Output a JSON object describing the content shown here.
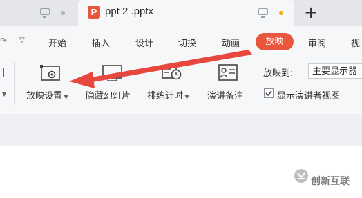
{
  "titlebar": {
    "active_tab_title": "ppt 2 .pptx",
    "active_tab_icon": "P",
    "new_tab": "+",
    "unsaved_dot_color": "#f5a623"
  },
  "ribbon_tabs": [
    {
      "label": "开始"
    },
    {
      "label": "插入"
    },
    {
      "label": "设计"
    },
    {
      "label": "切换"
    },
    {
      "label": "动画"
    },
    {
      "label": "放映"
    },
    {
      "label": "审阅"
    },
    {
      "label": "视"
    }
  ],
  "commands": {
    "slideshow_settings": "放映设置",
    "hide_slide": "隐藏幻灯片",
    "rehearse_timing": "排练计时",
    "speaker_notes": "演讲备注",
    "show_on_label": "放映到:",
    "show_on_value": "主要显示器",
    "presenter_view_label": "显示演讲者视图",
    "presenter_view_checked": true
  },
  "watermark": {
    "text": "创新互联"
  },
  "colors": {
    "accent": "#e8573d",
    "annotation_arrow": "#e8473d"
  }
}
